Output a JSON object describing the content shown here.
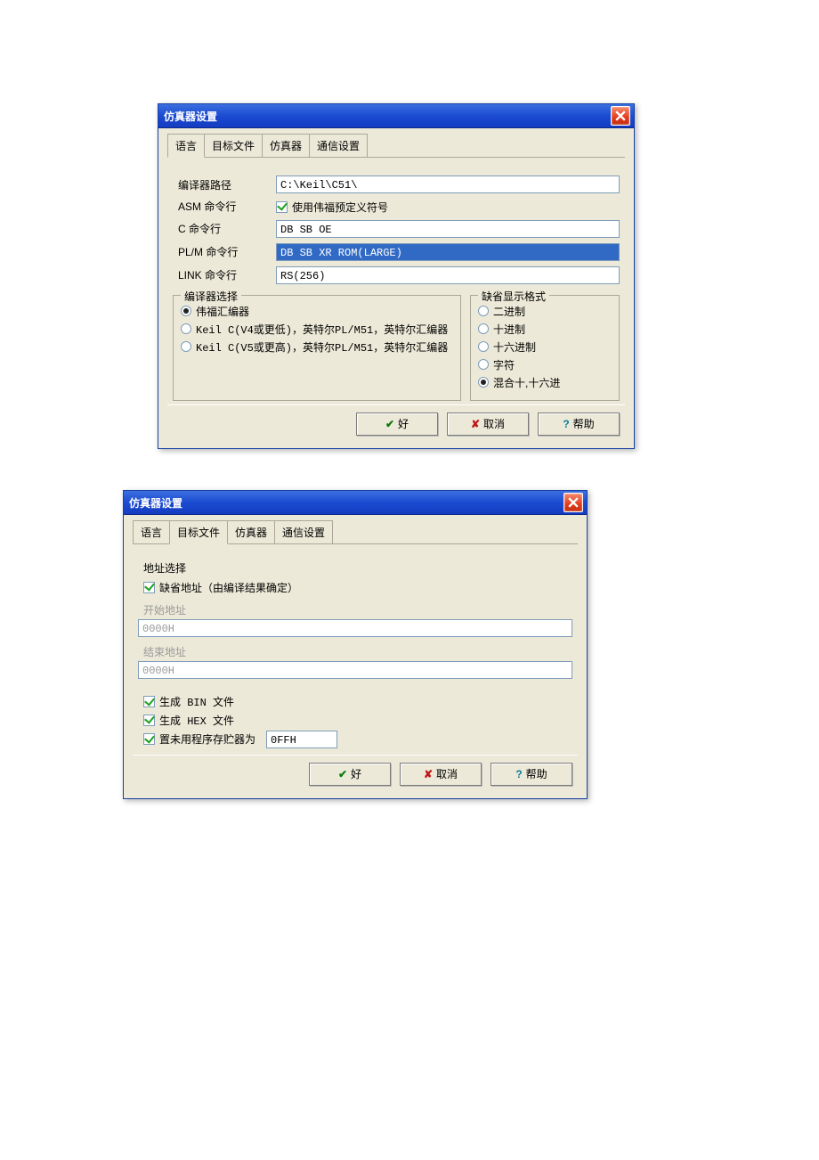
{
  "dialog1": {
    "title": "仿真器设置"
  },
  "dialog2": {
    "title": "仿真器设置"
  },
  "tabs": {
    "language": "语言",
    "targetfile": "目标文件",
    "emulator": "仿真器",
    "comm": "通信设置"
  },
  "buttons": {
    "ok": "好",
    "cancel": "取消",
    "help": "帮助"
  },
  "d1": {
    "compilerPath": {
      "label": "编译器路径",
      "value": "C:\\Keil\\C51\\"
    },
    "asm": {
      "label": "ASM 命令行",
      "checkbox": "使用伟福预定义符号"
    },
    "c": {
      "label": "C 命令行",
      "value": "DB SB OE"
    },
    "plm": {
      "label": "PL/M 命令行",
      "value": "DB SB XR ROM(LARGE)"
    },
    "link": {
      "label": "LINK 命令行",
      "value": "RS(256)"
    },
    "compilerSelect": {
      "legend": "编译器选择",
      "opts": [
        "伟福汇编器",
        "Keil C(V4或更低)，英特尔PL/M51，英特尔汇编器",
        "Keil C(V5或更高)，英特尔PL/M51，英特尔汇编器"
      ],
      "selected": 0
    },
    "dispFmt": {
      "legend": "缺省显示格式",
      "opts": [
        "二进制",
        "十进制",
        "十六进制",
        "字符",
        "混合十,十六进"
      ],
      "selected": 4
    }
  },
  "d2": {
    "addrSelect": "地址选择",
    "defaultAddr": "缺省地址（由编译结果确定）",
    "startAddr": {
      "label": "开始地址",
      "value": "0000H"
    },
    "endAddr": {
      "label": "结束地址",
      "value": "0000H"
    },
    "genBin": "生成 BIN 文件",
    "genHex": "生成 HEX 文件",
    "fillUnused": {
      "label": "置未用程序存贮器为",
      "value": "0FFH"
    }
  }
}
